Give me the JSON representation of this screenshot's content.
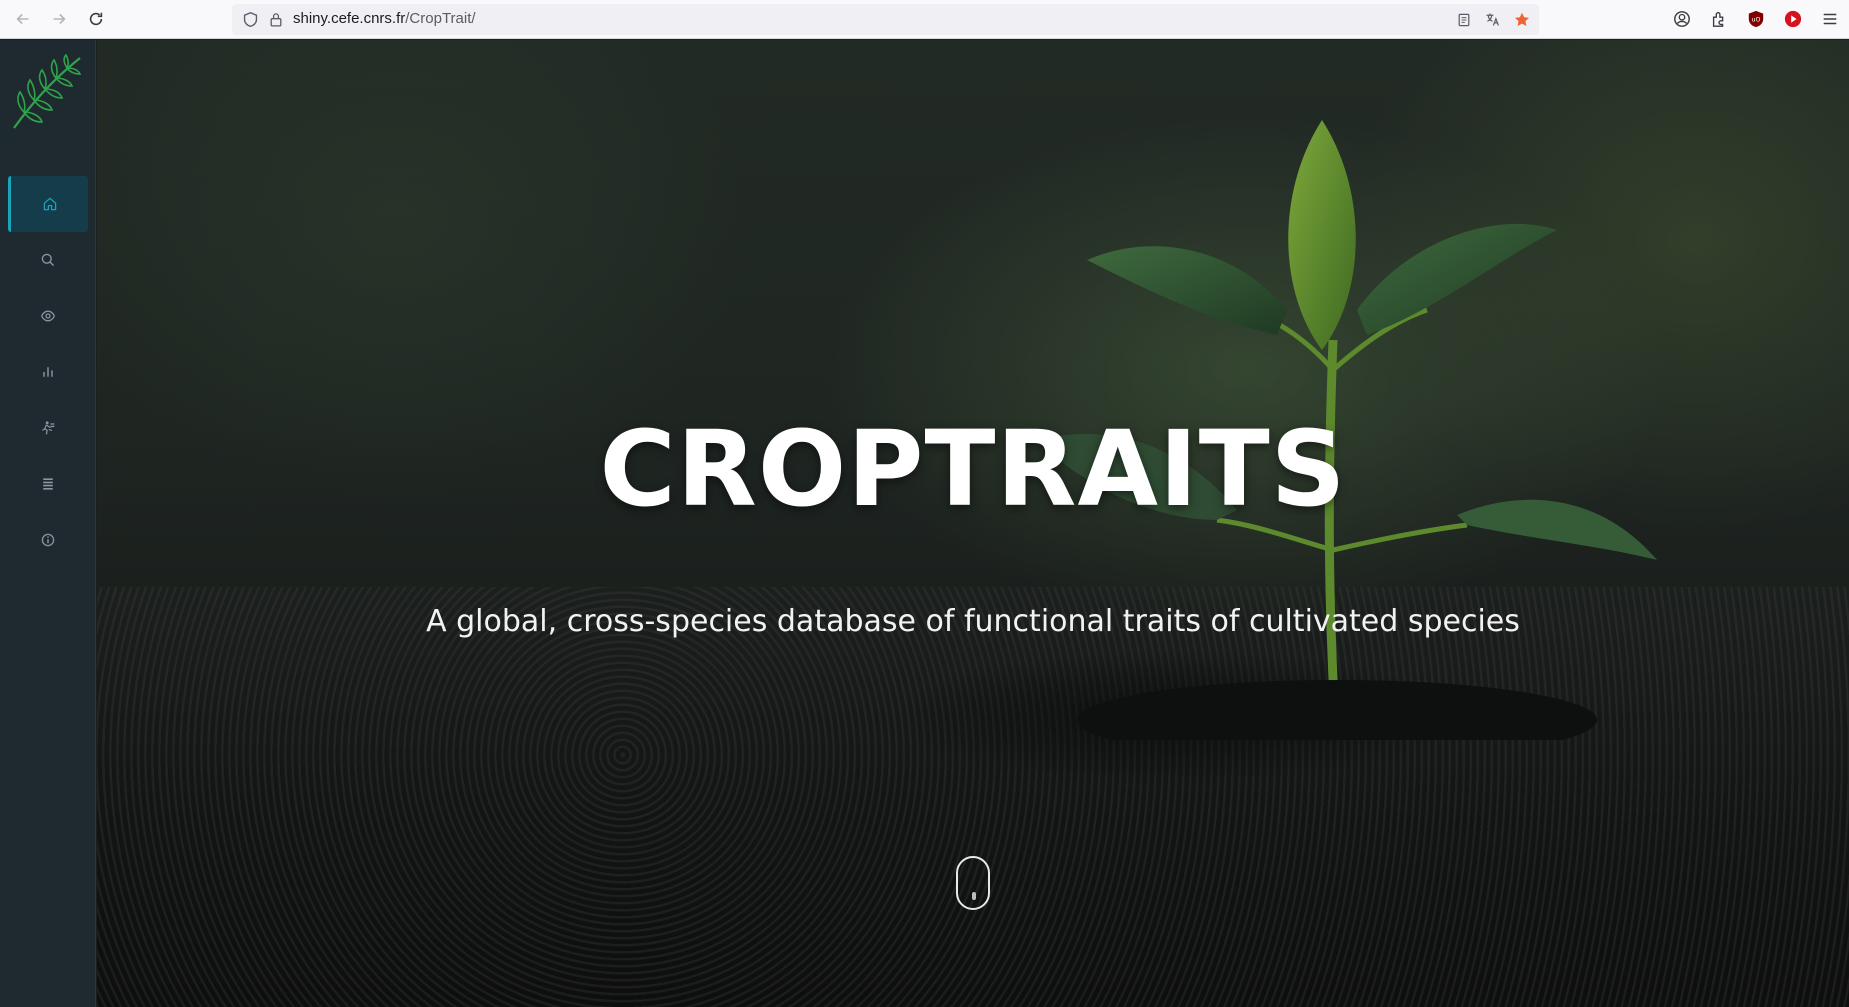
{
  "browser": {
    "url_host": "shiny.cefe.cnrs.fr",
    "url_path": "/CropTrait/"
  },
  "sidebar": {
    "items": [
      {
        "icon": "home-icon",
        "active": true
      },
      {
        "icon": "search-icon",
        "active": false
      },
      {
        "icon": "eye-icon",
        "active": false
      },
      {
        "icon": "bar-chart-icon",
        "active": false
      },
      {
        "icon": "running-person-icon",
        "active": false
      },
      {
        "icon": "list-icon",
        "active": false
      },
      {
        "icon": "info-icon",
        "active": false
      }
    ]
  },
  "hero": {
    "title": "CROPTRAITS",
    "subtitle": "A global, cross-species database of functional traits of cultivated species"
  },
  "colors": {
    "sidebar_bg": "#1f2a30",
    "accent": "#1aa3bd",
    "logo_green": "#2fa34a"
  }
}
